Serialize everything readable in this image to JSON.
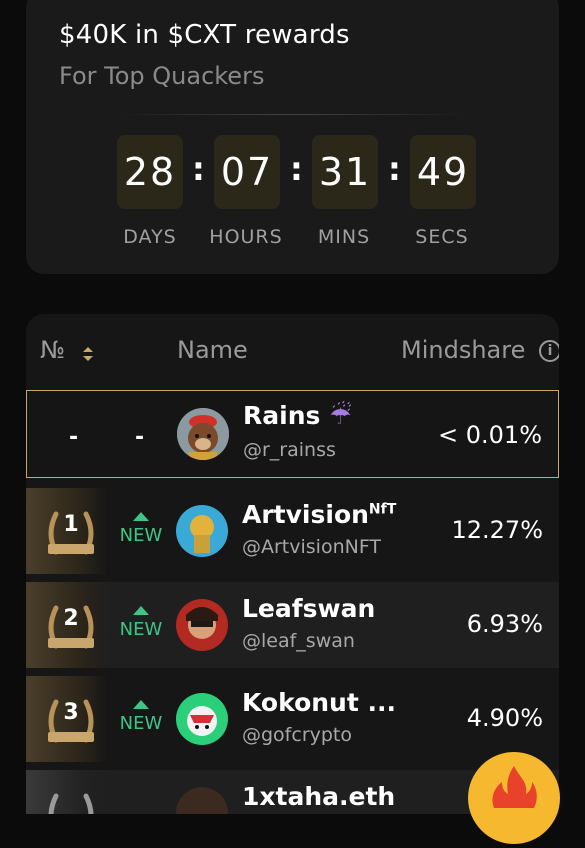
{
  "rewards": {
    "title": "$40K in $CXT rewards",
    "subtitle": "For Top Quackers"
  },
  "countdown": [
    {
      "value": "28",
      "label": "DAYS"
    },
    {
      "value": "07",
      "label": "HOURS"
    },
    {
      "value": "31",
      "label": "MINS"
    },
    {
      "value": "49",
      "label": "SECS"
    }
  ],
  "table": {
    "headers": {
      "rank": "№",
      "name": "Name",
      "mindshare": "Mindshare"
    },
    "me": {
      "rank": "-",
      "change": "-",
      "name": "Rains",
      "emoji": "☔",
      "handle": "@r_rainss",
      "mindshare": "< 0.01%"
    },
    "rows": [
      {
        "rank": "1",
        "badge": "NEW",
        "name": "Artvision",
        "name_sup": "NfT",
        "handle": "@ArtvisionNFT",
        "mindshare": "12.27%"
      },
      {
        "rank": "2",
        "badge": "NEW",
        "name": "Leafswan",
        "name_sup": "",
        "handle": "@leaf_swan",
        "mindshare": "6.93%"
      },
      {
        "rank": "3",
        "badge": "NEW",
        "name": "Kokonut ...",
        "name_sup": "",
        "handle": "@gofcrypto",
        "mindshare": "4.90%"
      },
      {
        "rank": "",
        "badge": "",
        "name": "1xtaha.eth",
        "name_sup": "",
        "handle": "",
        "mindshare": ""
      }
    ]
  },
  "colors": {
    "accent_gold": "#c9a66b",
    "new_green": "#3ec486",
    "fab": "#f5b82e"
  },
  "icons": [
    "sort-icon",
    "info-icon",
    "laurel-icon",
    "new-arrow-icon",
    "fire-icon"
  ]
}
